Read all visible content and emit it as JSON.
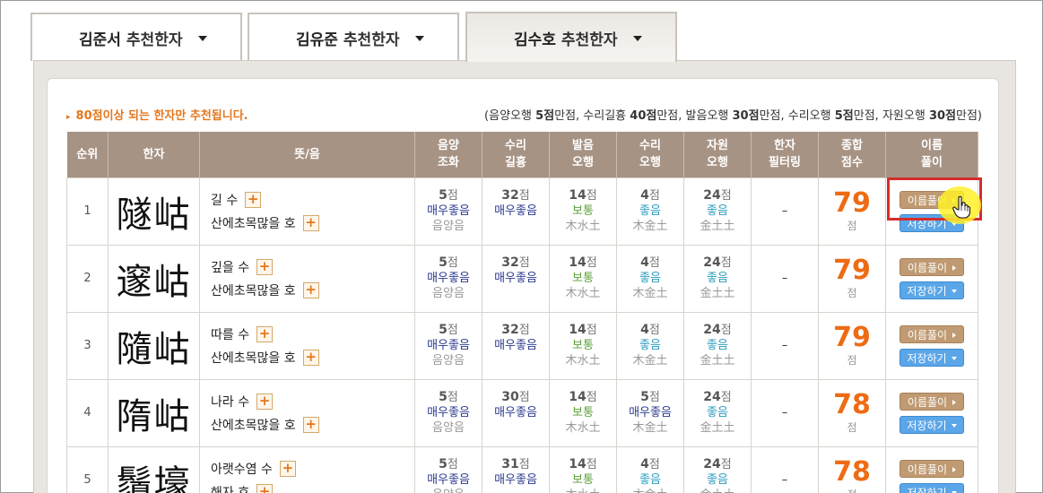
{
  "tabs": [
    {
      "name": "김준서",
      "label": "추천한자"
    },
    {
      "name": "김유준",
      "label": "추천한자"
    },
    {
      "name": "김수호",
      "label": "추천한자",
      "active": true
    }
  ],
  "notice": "80점이상 되는 한자만 추천됩니다.",
  "scoring": {
    "prefix": "(음양오행 ",
    "p1": "5점",
    "t1": "만점, 수리길흉 ",
    "p2": "40점",
    "t2": "만점, 발음오행 ",
    "p3": "30점",
    "t3": "만점, 수리오행 ",
    "p4": "5점",
    "t4": "만점, 자원오행 ",
    "p5": "30점",
    "suffix": "만점)"
  },
  "headers": {
    "rank": "순위",
    "hanja": "한자",
    "meaning": "뜻/음",
    "yinyang_1": "음양",
    "yinyang_2": "조화",
    "suri_1": "수리",
    "suri_2": "길흉",
    "sound_1": "발음",
    "sound_2": "오행",
    "surio_1": "수리",
    "surio_2": "오행",
    "jawon_1": "자원",
    "jawon_2": "오행",
    "filter_1": "한자",
    "filter_2": "필터링",
    "total_1": "종합",
    "total_2": "점수",
    "interp_1": "이름",
    "interp_2": "풀이"
  },
  "buttons": {
    "interpret": "이름풀이",
    "save": "저장하기"
  },
  "unit_point": "점",
  "rows": [
    {
      "rank": "1",
      "hanja": "隧岵",
      "m1": "길 수",
      "m2": "산에초목많을 호",
      "yy": "5",
      "yy_g": "매우좋음",
      "yy_e": "음양음",
      "sr": "32",
      "sr_g": "매우좋음",
      "so": "14",
      "so_g": "보통",
      "so_e": "木水土",
      "sro": "4",
      "sro_g": "좋음",
      "sro_e": "木金土",
      "jw": "24",
      "jw_g": "좋음",
      "jw_e": "金土土",
      "filter": "–",
      "total": "79"
    },
    {
      "rank": "2",
      "hanja": "邃岵",
      "m1": "깊을 수",
      "m2": "산에초목많을 호",
      "yy": "5",
      "yy_g": "매우좋음",
      "yy_e": "음양음",
      "sr": "32",
      "sr_g": "매우좋음",
      "so": "14",
      "so_g": "보통",
      "so_e": "木水土",
      "sro": "4",
      "sro_g": "좋음",
      "sro_e": "木金土",
      "jw": "24",
      "jw_g": "좋음",
      "jw_e": "金土土",
      "filter": "–",
      "total": "79"
    },
    {
      "rank": "3",
      "hanja": "隨岵",
      "m1": "따를 수",
      "m2": "산에초목많을 호",
      "yy": "5",
      "yy_g": "매우좋음",
      "yy_e": "음양음",
      "sr": "32",
      "sr_g": "매우좋음",
      "so": "14",
      "so_g": "보통",
      "so_e": "木水土",
      "sro": "4",
      "sro_g": "좋음",
      "sro_e": "木金土",
      "jw": "24",
      "jw_g": "좋음",
      "jw_e": "金土土",
      "filter": "–",
      "total": "79"
    },
    {
      "rank": "4",
      "hanja": "隋岵",
      "m1": "나라 수",
      "m2": "산에초목많을 호",
      "yy": "5",
      "yy_g": "매우좋음",
      "yy_e": "음양음",
      "sr": "30",
      "sr_g": "매우좋음",
      "so": "14",
      "so_g": "보통",
      "so_e": "木水土",
      "sro": "5",
      "sro_g": "매우좋음",
      "sro_e": "木金土",
      "jw": "24",
      "jw_g": "좋음",
      "jw_e": "金土土",
      "filter": "–",
      "total": "78"
    },
    {
      "rank": "5",
      "hanja": "鬚壕",
      "m1": "아랫수염 수",
      "m2": "해자 호",
      "yy": "5",
      "yy_g": "매우좋음",
      "yy_e": "음양음",
      "sr": "31",
      "sr_g": "매우좋음",
      "so": "14",
      "so_g": "보통",
      "so_e": "木水土",
      "sro": "4",
      "sro_g": "좋음",
      "sro_e": "木金土",
      "jw": "24",
      "jw_g": "좋음",
      "jw_e": "金土土",
      "filter": "–",
      "total": "78"
    }
  ],
  "colors": {
    "header_bg": "#a79384",
    "accent_orange": "#ee6b14",
    "highlight_red": "#d62c2c"
  }
}
